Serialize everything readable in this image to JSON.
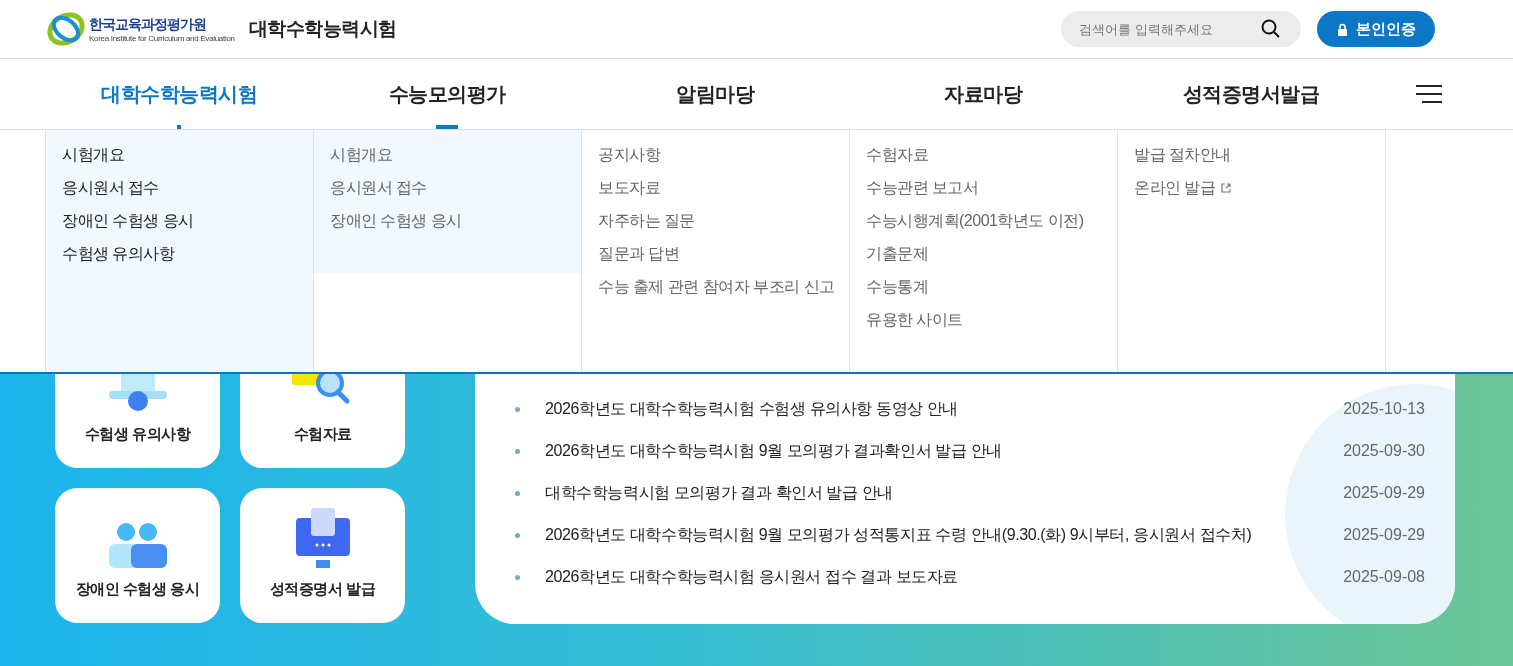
{
  "header": {
    "logo_name": "한국교육과정평가원",
    "logo_subtitle": "Korea Institute for Curriculum and Evaluation",
    "site_title": "대학수학능력시험",
    "search": {
      "placeholder": "검색어를 입력해주세요"
    },
    "auth_button": "본인인증"
  },
  "nav": [
    {
      "label": "대학수학능력시험",
      "selected": true,
      "hovered": false
    },
    {
      "label": "수능모의평가",
      "selected": false,
      "hovered": true
    },
    {
      "label": "알림마당",
      "selected": false,
      "hovered": false
    },
    {
      "label": "자료마당",
      "selected": false,
      "hovered": false
    },
    {
      "label": "성적증명서발급",
      "selected": false,
      "hovered": false
    }
  ],
  "mega_menu": [
    {
      "selected": true,
      "hovered": false,
      "items": [
        {
          "label": "시험개요",
          "external": false
        },
        {
          "label": "응시원서 접수",
          "external": false
        },
        {
          "label": "장애인 수험생 응시",
          "external": false
        },
        {
          "label": "수험생 유의사항",
          "external": false
        }
      ]
    },
    {
      "selected": false,
      "hovered": true,
      "items": [
        {
          "label": "시험개요",
          "external": false
        },
        {
          "label": "응시원서 접수",
          "external": false
        },
        {
          "label": "장애인 수험생 응시",
          "external": false
        }
      ]
    },
    {
      "selected": false,
      "hovered": false,
      "items": [
        {
          "label": "공지사항",
          "external": false
        },
        {
          "label": "보도자료",
          "external": false
        },
        {
          "label": "자주하는 질문",
          "external": false
        },
        {
          "label": "질문과 답변",
          "external": false
        },
        {
          "label": "수능 출제 관련 참여자 부조리 신고",
          "external": false
        }
      ]
    },
    {
      "selected": false,
      "hovered": false,
      "items": [
        {
          "label": "수험자료",
          "external": false
        },
        {
          "label": "수능관련 보고서",
          "external": false
        },
        {
          "label": "수능시행계획(2001학년도 이전)",
          "external": false
        },
        {
          "label": "기출문제",
          "external": false
        },
        {
          "label": "수능통계",
          "external": false
        },
        {
          "label": "유용한 사이트",
          "external": false
        }
      ]
    },
    {
      "selected": false,
      "hovered": false,
      "items": [
        {
          "label": "발급 절차안내",
          "external": false
        },
        {
          "label": "온라인 발급",
          "external": true
        }
      ]
    }
  ],
  "quick_links": [
    {
      "label": "수험생 유의사항",
      "kind": "bell"
    },
    {
      "label": "수험자료",
      "kind": "search"
    },
    {
      "label": "장애인 수험생 응시",
      "kind": "people"
    },
    {
      "label": "성적증명서 발급",
      "kind": "monitor"
    }
  ],
  "news": [
    {
      "title": "2026학년도 대학수학능력시험 수험생 유의사항 동영상 안내",
      "date": "2025-10-13"
    },
    {
      "title": "2026학년도 대학수학능력시험 9월 모의평가 결과확인서 발급 안내",
      "date": "2025-09-30"
    },
    {
      "title": "대학수학능력시험 모의평가 결과 확인서 발급 안내",
      "date": "2025-09-29"
    },
    {
      "title": "2026학년도 대학수학능력시험 9월 모의평가 성적통지표 수령 안내(9.30.(화) 9시부터, 응시원서 접수처)",
      "date": "2025-09-29"
    },
    {
      "title": "2026학년도 대학수학능력시험 응시원서 접수 결과 보도자료",
      "date": "2025-09-08"
    }
  ]
}
